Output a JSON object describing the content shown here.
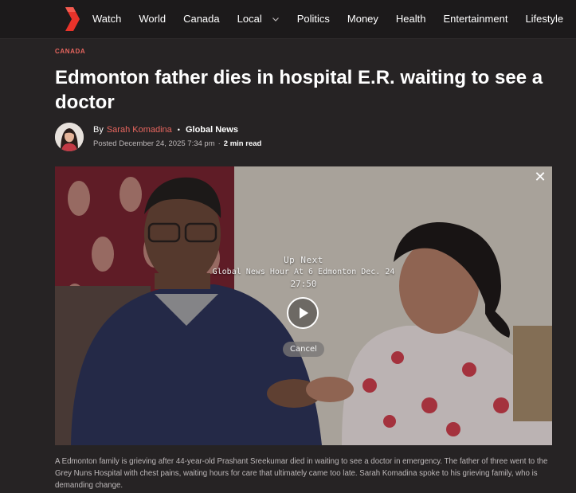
{
  "nav": {
    "logo_icon": "global-news-logo-icon",
    "items": [
      {
        "label": "Watch"
      },
      {
        "label": "World"
      },
      {
        "label": "Canada"
      },
      {
        "label": "Local",
        "dropdown_icon": "chevron-down-icon"
      },
      {
        "label": "Politics"
      },
      {
        "label": "Money"
      },
      {
        "label": "Health"
      },
      {
        "label": "Entertainment"
      },
      {
        "label": "Lifestyle"
      }
    ]
  },
  "article": {
    "category": "CANADA",
    "headline": "Edmonton father dies in hospital E.R. waiting to see a doctor",
    "byline": {
      "by": "By",
      "author": "Sarah Komadina",
      "separator": "•",
      "outlet": "Global News"
    },
    "meta": {
      "posted": "Posted December 24, 2025 7:34 pm",
      "separator": "·",
      "read_time": "2 min read"
    },
    "caption": "A Edmonton family is grieving after 44-year-old Prashant Sreekumar died in waiting to see a doctor in emergency. The father of three went to the Grey Nuns Hospital with chest pains, waiting hours for care that ultimately came too late. Sarah Komadina spoke to his grieving family, who is demanding change."
  },
  "video": {
    "close_icon": "close-icon",
    "close_glyph": "✕",
    "up_next_label": "Up Next",
    "up_next_title": "Global News Hour At 6 Edmonton Dec. 24",
    "up_next_duration": "27:50",
    "play_icon": "play-icon",
    "cancel_label": "Cancel"
  },
  "colors": {
    "background": "#262324",
    "nav_background": "#1c1a1b",
    "accent": "#e8665f",
    "text_primary": "#ffffff",
    "text_secondary": "#bdb8b9"
  }
}
